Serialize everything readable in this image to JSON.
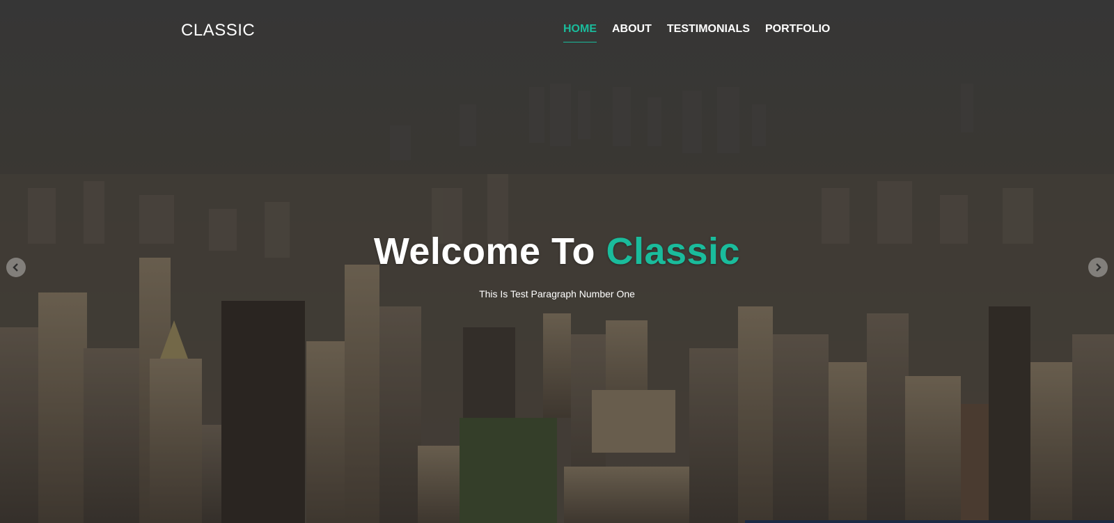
{
  "brand": {
    "name": "CLASSIC"
  },
  "nav": {
    "items": [
      {
        "label": "HOME",
        "active": true
      },
      {
        "label": "ABOUT",
        "active": false
      },
      {
        "label": "TESTIMONIALS",
        "active": false
      },
      {
        "label": "PORTFOLIO",
        "active": false
      }
    ]
  },
  "hero": {
    "title_prefix": "Welcome To ",
    "title_accent": "Classic",
    "subtitle": "This Is Test Paragraph Number One",
    "background": "city-skyline-image"
  },
  "carousel": {
    "prev_icon": "chevron-left-icon",
    "next_icon": "chevron-right-icon"
  },
  "colors": {
    "accent": "#1abc9c",
    "text": "#ffffff",
    "overlay": "#3d3d3d"
  }
}
